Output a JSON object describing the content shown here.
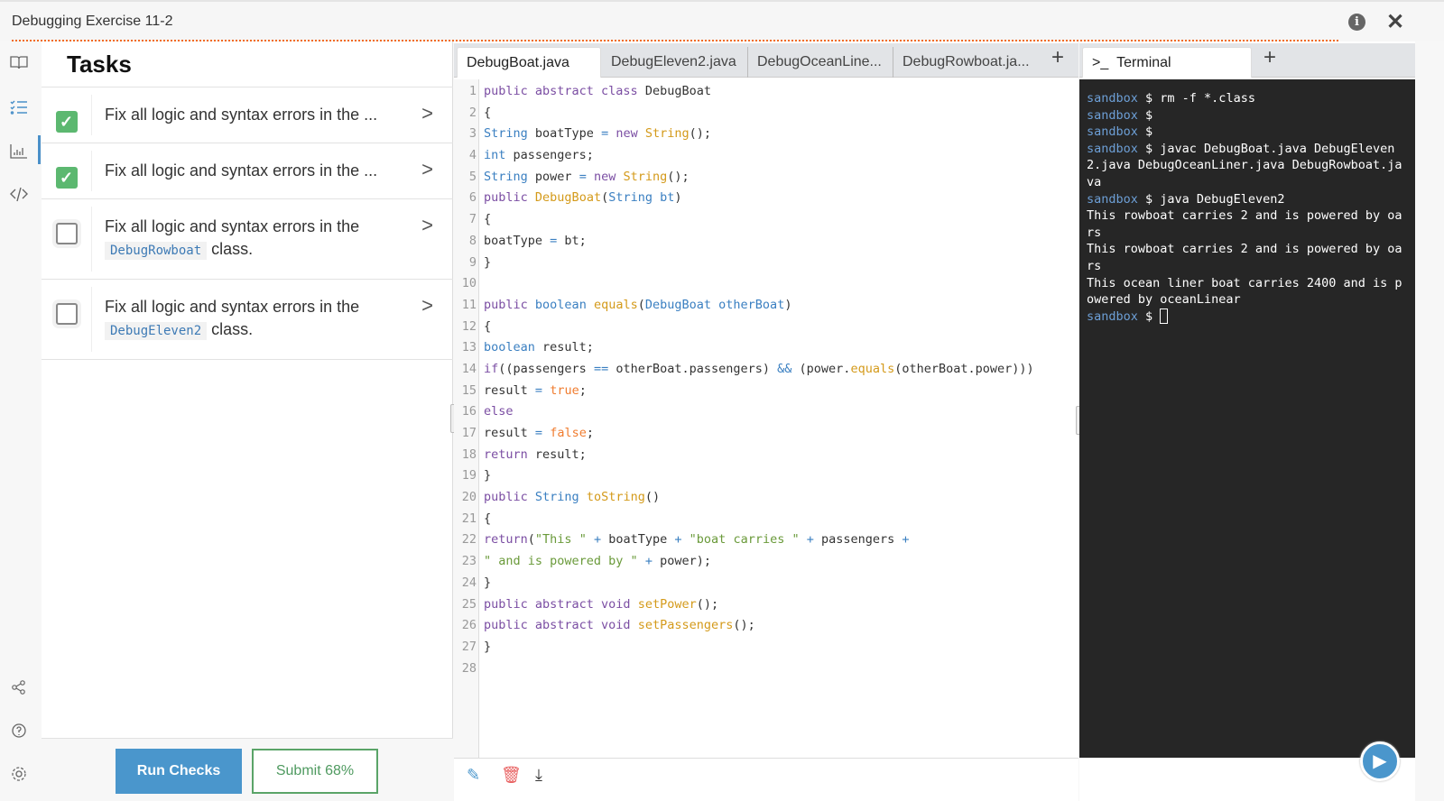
{
  "window": {
    "title": "Debugging Exercise 11-2",
    "info_icon": "info-icon",
    "close_icon": "close-icon"
  },
  "rail": [
    "book-icon",
    "checklist-icon",
    "chart-icon",
    "code-icon",
    "share-icon",
    "help-icon",
    "settings-icon"
  ],
  "tasks": {
    "title": "Tasks",
    "items": [
      {
        "done": true,
        "text": "Fix all logic and syntax errors in the ...",
        "code": "",
        "suffix": ""
      },
      {
        "done": true,
        "text": "Fix all logic and syntax errors in the ...",
        "code": "",
        "suffix": ""
      },
      {
        "done": false,
        "text": "Fix all logic and syntax errors in the",
        "code": "DebugRowboat",
        "suffix": "class."
      },
      {
        "done": false,
        "text": "Fix all logic and syntax errors in the",
        "code": "DebugEleven2",
        "suffix": "class."
      }
    ],
    "run_label": "Run Checks",
    "submit_label": "Submit 68%"
  },
  "editor": {
    "tabs": [
      "DebugBoat.java",
      "DebugEleven2.java",
      "DebugOceanLine...",
      "DebugRowboat.ja..."
    ],
    "active_tab": 0,
    "lines": [
      [
        [
          "public abstract class ",
          "k"
        ],
        [
          "DebugBoat",
          ""
        ]
      ],
      [
        [
          "{",
          ""
        ]
      ],
      [
        [
          "String",
          "t"
        ],
        [
          " boatType ",
          ""
        ],
        [
          "=",
          "t"
        ],
        [
          " ",
          ""
        ],
        [
          "new",
          "k"
        ],
        [
          " ",
          ""
        ],
        [
          "String",
          "f"
        ],
        [
          "();",
          ""
        ]
      ],
      [
        [
          "int",
          "t"
        ],
        [
          " passengers;",
          ""
        ]
      ],
      [
        [
          "String",
          "t"
        ],
        [
          " power ",
          ""
        ],
        [
          "=",
          "t"
        ],
        [
          " ",
          ""
        ],
        [
          "new",
          "k"
        ],
        [
          " ",
          ""
        ],
        [
          "String",
          "f"
        ],
        [
          "();",
          ""
        ]
      ],
      [
        [
          "public",
          "k"
        ],
        [
          " ",
          ""
        ],
        [
          "DebugBoat",
          "f"
        ],
        [
          "(",
          ""
        ],
        [
          "String bt",
          "t"
        ],
        [
          ")",
          ""
        ]
      ],
      [
        [
          "{",
          ""
        ]
      ],
      [
        [
          "boatType ",
          ""
        ],
        [
          "=",
          "t"
        ],
        [
          " bt;",
          ""
        ]
      ],
      [
        [
          "}",
          ""
        ]
      ],
      [],
      [
        [
          "public",
          "k"
        ],
        [
          " ",
          ""
        ],
        [
          "boolean",
          "t"
        ],
        [
          " ",
          ""
        ],
        [
          "equals",
          "f"
        ],
        [
          "(",
          ""
        ],
        [
          "DebugBoat otherBoat",
          "t"
        ],
        [
          ")",
          ""
        ]
      ],
      [
        [
          "{",
          ""
        ]
      ],
      [
        [
          "boolean",
          "t"
        ],
        [
          " result;",
          ""
        ]
      ],
      [
        [
          "if",
          "k"
        ],
        [
          "((passengers ",
          ""
        ],
        [
          "==",
          "t"
        ],
        [
          " otherBoat.passengers) ",
          ""
        ],
        [
          "&&",
          "t"
        ],
        [
          " (power.",
          ""
        ],
        [
          "equals",
          "f"
        ],
        [
          "(otherBoat.power)))",
          ""
        ]
      ],
      [
        [
          "result ",
          ""
        ],
        [
          "=",
          "t"
        ],
        [
          " ",
          ""
        ],
        [
          "true",
          "b"
        ],
        [
          ";",
          ""
        ]
      ],
      [
        [
          "else",
          "k"
        ]
      ],
      [
        [
          "result ",
          ""
        ],
        [
          "=",
          "t"
        ],
        [
          " ",
          ""
        ],
        [
          "false",
          "b"
        ],
        [
          ";",
          ""
        ]
      ],
      [
        [
          "return",
          "k"
        ],
        [
          " result;",
          ""
        ]
      ],
      [
        [
          "}",
          ""
        ]
      ],
      [
        [
          "public",
          "k"
        ],
        [
          " ",
          ""
        ],
        [
          "String",
          "t"
        ],
        [
          " ",
          ""
        ],
        [
          "toString",
          "f"
        ],
        [
          "()",
          ""
        ]
      ],
      [
        [
          "{",
          ""
        ]
      ],
      [
        [
          "return",
          "k"
        ],
        [
          "(",
          ""
        ],
        [
          "\"This \"",
          "s"
        ],
        [
          " ",
          ""
        ],
        [
          "+",
          "t"
        ],
        [
          " boatType ",
          ""
        ],
        [
          "+",
          "t"
        ],
        [
          " ",
          ""
        ],
        [
          "\"boat carries \"",
          "s"
        ],
        [
          " ",
          ""
        ],
        [
          "+",
          "t"
        ],
        [
          " passengers ",
          ""
        ],
        [
          "+",
          "t"
        ]
      ],
      [
        [
          "\" and is powered by \"",
          "s"
        ],
        [
          " ",
          ""
        ],
        [
          "+",
          "t"
        ],
        [
          " power);",
          ""
        ]
      ],
      [
        [
          "}",
          ""
        ]
      ],
      [
        [
          "public abstract void ",
          "k"
        ],
        [
          "setPower",
          "f"
        ],
        [
          "();",
          ""
        ]
      ],
      [
        [
          "public abstract void ",
          "k"
        ],
        [
          "setPassengers",
          "f"
        ],
        [
          "();",
          ""
        ]
      ],
      [
        [
          "}",
          ""
        ]
      ],
      []
    ],
    "footer_icons": [
      "pencil-icon",
      "trash-icon",
      "download-icon"
    ]
  },
  "terminal": {
    "tab_label": "Terminal",
    "prompt": "sandbox",
    "lines": [
      {
        "prompt": true,
        "text": " $ rm -f *.class"
      },
      {
        "prompt": true,
        "text": " $"
      },
      {
        "prompt": true,
        "text": " $"
      },
      {
        "prompt": true,
        "text": " $ javac DebugBoat.java DebugEleven2.java DebugOceanLiner.java DebugRowboat.java"
      },
      {
        "prompt": true,
        "text": " $ java DebugEleven2"
      },
      {
        "prompt": false,
        "text": "This rowboat carries 2 and is powered by oars"
      },
      {
        "prompt": false,
        "text": "This rowboat carries 2 and is powered by oars"
      },
      {
        "prompt": false,
        "text": "This ocean liner boat carries 2400 and is powered by oceanLinear"
      },
      {
        "prompt": true,
        "text": " $ ",
        "cursor": true
      }
    ]
  },
  "colors": {
    "accent": "#4a96cc",
    "success": "#5cb870",
    "orange": "#f26b21",
    "terminal_bg": "#262626"
  }
}
